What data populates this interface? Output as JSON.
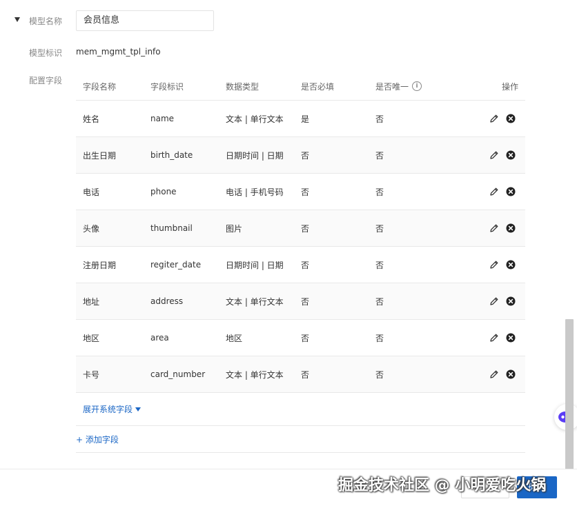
{
  "model": {
    "name_label": "模型名称",
    "name_value": "会员信息",
    "id_label": "模型标识",
    "id_value": "mem_mgmt_tpl_info",
    "fields_label": "配置字段"
  },
  "table": {
    "headers": [
      "字段名称",
      "字段标识",
      "数据类型",
      "是否必填",
      "是否唯一",
      "操作"
    ],
    "rows": [
      [
        "姓名",
        "name",
        "文本 | 单行文本",
        "是",
        "否"
      ],
      [
        "出生日期",
        "birth_date",
        "日期时间 | 日期",
        "否",
        "否"
      ],
      [
        "电话",
        "phone",
        "电话 | 手机号码",
        "否",
        "否"
      ],
      [
        "头像",
        "thumbnail",
        "图片",
        "否",
        "否"
      ],
      [
        "注册日期",
        "regiter_date",
        "日期时间 | 日期",
        "否",
        "否"
      ],
      [
        "地址",
        "address",
        "文本 | 单行文本",
        "否",
        "否"
      ],
      [
        "地区",
        "area",
        "地区",
        "否",
        "否"
      ],
      [
        "卡号",
        "card_number",
        "文本 | 单行文本",
        "否",
        "否"
      ]
    ],
    "info_icon": "info-circle-icon",
    "edit_icon": "pencil-icon",
    "delete_icon": "close-circle-icon"
  },
  "links": {
    "expand": "展开系统字段",
    "add_field": "+ 添加字段"
  },
  "footer": {
    "save_label": "提交"
  },
  "watermark": "掘金技术社区 @ 小明爱吃火锅",
  "colors": {
    "link": "#1a66c5",
    "primary": "#1a66c5",
    "border": "#e8e8e8"
  }
}
